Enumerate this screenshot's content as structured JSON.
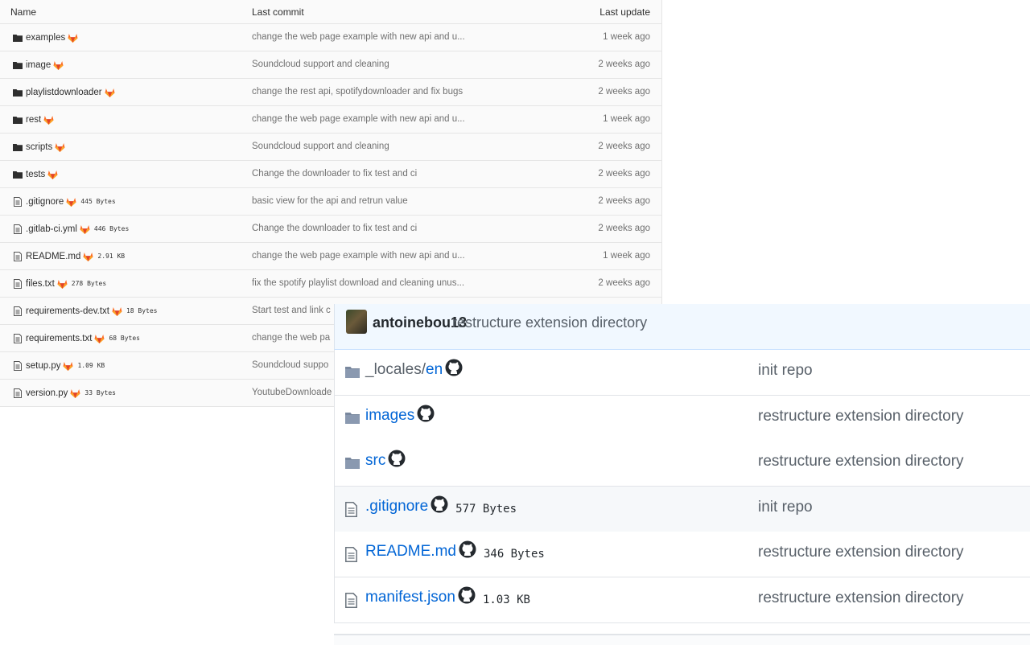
{
  "gitlab": {
    "columns": {
      "name": "Name",
      "last_commit": "Last commit",
      "last_update": "Last update"
    },
    "rows": [
      {
        "type": "folder",
        "name": "examples",
        "size": "",
        "commit": "change the web page example with new api and u...",
        "updated": "1 week ago"
      },
      {
        "type": "folder",
        "name": "image",
        "size": "",
        "commit": "Soundcloud support and cleaning",
        "updated": "2 weeks ago"
      },
      {
        "type": "folder",
        "name": "playlistdownloader",
        "size": "",
        "commit": "change the rest api, spotifydownloader and fix bugs",
        "updated": "2 weeks ago"
      },
      {
        "type": "folder",
        "name": "rest",
        "size": "",
        "commit": "change the web page example with new api and u...",
        "updated": "1 week ago"
      },
      {
        "type": "folder",
        "name": "scripts",
        "size": "",
        "commit": "Soundcloud support and cleaning",
        "updated": "2 weeks ago"
      },
      {
        "type": "folder",
        "name": "tests",
        "size": "",
        "commit": "Change the downloader to fix test and ci",
        "updated": "2 weeks ago"
      },
      {
        "type": "file",
        "name": ".gitignore",
        "size": "445 Bytes",
        "commit": "basic view for the api and retrun value",
        "updated": "2 weeks ago"
      },
      {
        "type": "file",
        "name": ".gitlab-ci.yml",
        "size": "446 Bytes",
        "commit": "Change the downloader to fix test and ci",
        "updated": "2 weeks ago"
      },
      {
        "type": "file",
        "name": "README.md",
        "size": "2.91 KB",
        "commit": "change the web page example with new api and u...",
        "updated": "1 week ago"
      },
      {
        "type": "file",
        "name": "files.txt",
        "size": "278 Bytes",
        "commit": "fix the spotify playlist download and cleaning unus...",
        "updated": "2 weeks ago"
      },
      {
        "type": "file",
        "name": "requirements-dev.txt",
        "size": "18 Bytes",
        "commit": "Start test and link c",
        "updated": ""
      },
      {
        "type": "file",
        "name": "requirements.txt",
        "size": "68 Bytes",
        "commit": "change the web pa",
        "updated": ""
      },
      {
        "type": "file",
        "name": "setup.py",
        "size": "1.09 KB",
        "commit": "Soundcloud suppo",
        "updated": ""
      },
      {
        "type": "file",
        "name": "version.py",
        "size": "33 Bytes",
        "commit": "YoutubeDownloade",
        "updated": ""
      }
    ]
  },
  "github": {
    "commit_author": "antoinebou13",
    "commit_message": "restructure extension directory",
    "rows": [
      {
        "type": "folder",
        "name_prefix": "_locales/",
        "name": "en",
        "size": "",
        "commit": "init repo"
      },
      {
        "type": "folder",
        "name_prefix": "",
        "name": "images",
        "size": "",
        "commit": "restructure extension directory"
      },
      {
        "type": "folder",
        "name_prefix": "",
        "name": "src",
        "size": "",
        "commit": "restructure extension directory"
      },
      {
        "type": "file",
        "name_prefix": "",
        "name": ".gitignore",
        "size": "577 Bytes",
        "commit": "init repo"
      },
      {
        "type": "file",
        "name_prefix": "",
        "name": "README.md",
        "size": "346 Bytes",
        "commit": "restructure extension directory"
      },
      {
        "type": "file",
        "name_prefix": "",
        "name": "manifest.json",
        "size": "1.03 KB",
        "commit": "restructure extension directory"
      }
    ]
  },
  "colors": {
    "gitlab_fox": "#e24329",
    "github_link": "#0366d6",
    "github_folder": "#79b8ff"
  },
  "icons": [
    "folder-icon",
    "file-icon",
    "gitlab-fox-icon",
    "github-octocat-icon",
    "avatar"
  ]
}
